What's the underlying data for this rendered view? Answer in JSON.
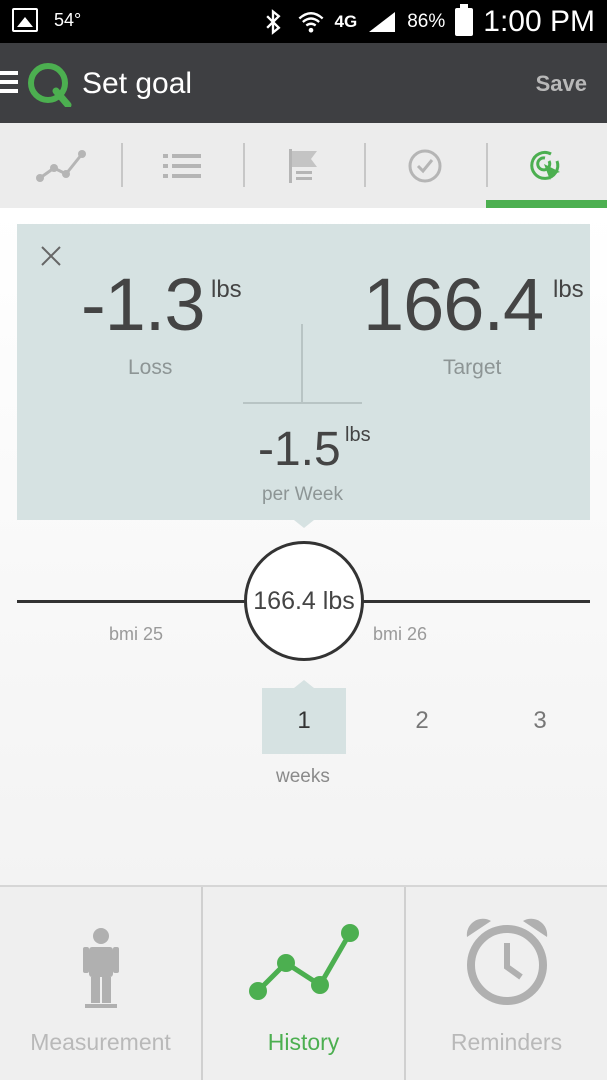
{
  "status_bar": {
    "temperature": "54°",
    "network": "4G",
    "battery": "86%",
    "time": "1:00 PM"
  },
  "app_bar": {
    "title": "Set goal",
    "save_label": "Save"
  },
  "tabs": [
    {
      "icon": "trend-line-icon",
      "active": false
    },
    {
      "icon": "list-icon",
      "active": false
    },
    {
      "icon": "flag-icon",
      "active": false
    },
    {
      "icon": "check-circle-icon",
      "active": false
    },
    {
      "icon": "target-icon",
      "active": true
    }
  ],
  "goal": {
    "loss_value": "-1.3",
    "loss_unit": "lbs",
    "loss_label": "Loss",
    "target_value": "166.4",
    "target_unit": "lbs",
    "target_label": "Target",
    "rate_value": "-1.5",
    "rate_unit": "lbs",
    "rate_label": "per Week"
  },
  "slider": {
    "value_label": "166.4 lbs",
    "bmi_left": "bmi 25",
    "bmi_right": "bmi 26"
  },
  "weeks": {
    "options": [
      "1",
      "2",
      "3"
    ],
    "selected_index": 0,
    "label": "weeks"
  },
  "bottom_nav": [
    {
      "label": "Measurement",
      "icon": "person-icon",
      "active": false
    },
    {
      "label": "History",
      "icon": "history-chart-icon",
      "active": true
    },
    {
      "label": "Reminders",
      "icon": "alarm-clock-icon",
      "active": false
    }
  ],
  "colors": {
    "accent": "#4caf50",
    "card_bg": "#d6e2e2",
    "appbar_bg": "#3e3f42"
  }
}
